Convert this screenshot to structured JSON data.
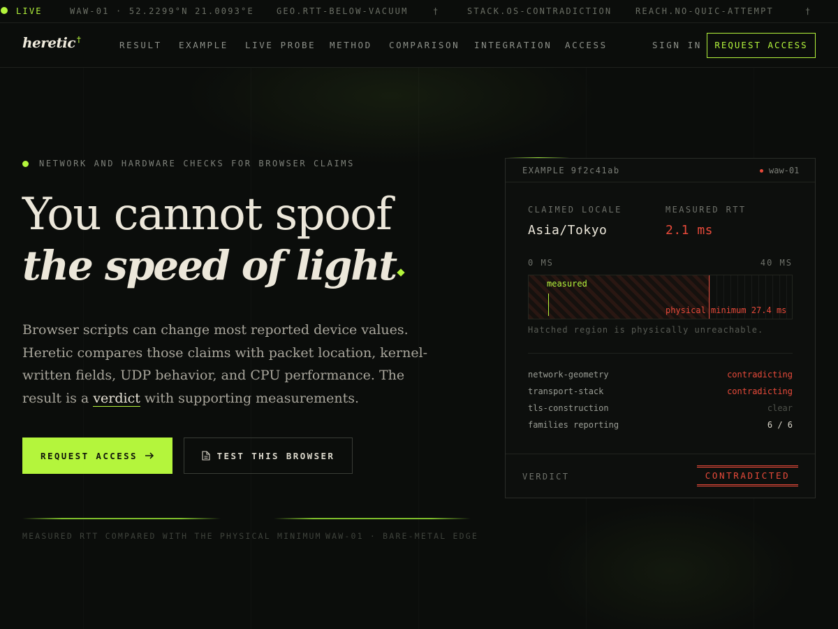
{
  "ticker": {
    "live": "LIVE",
    "items": [
      "WAW-01 · 52.2299°N 21.0093°E",
      "GEO.RTT-BELOW-VACUUM",
      "†",
      "STACK.OS-CONTRADICTION",
      "REACH.NO-QUIC-ATTEMPT",
      "†"
    ]
  },
  "nav": {
    "logo": "heretic",
    "logo_mark": "†",
    "links": [
      "RESULT",
      "EXAMPLE",
      "LIVE PROBE",
      "METHOD",
      "COMPARISON",
      "INTEGRATION",
      "ACCESS"
    ],
    "sign_in": "SIGN IN",
    "request_access": "REQUEST ACCESS"
  },
  "hero": {
    "eyebrow": "NETWORK AND HARDWARE CHECKS FOR BROWSER CLAIMS",
    "headline_line1": "You cannot spoof",
    "headline_line2": "the speed of light",
    "lede_before": "Browser scripts can change most reported device values. Heretic compares those claims with packet location, kernel-written fields, UDP behavior, and CPU performance. The result is a ",
    "lede_highlight": "verdict",
    "lede_after": " with supporting measurements.",
    "primary_button": "REQUEST ACCESS",
    "secondary_button": "TEST THIS BROWSER",
    "caption_left": "MEASURED RTT COMPARED WITH THE PHYSICAL MINIMUM",
    "caption_right": "WAW-01 · BARE-METAL EDGE"
  },
  "card": {
    "id": "EXAMPLE 9f2c41ab",
    "node": "waw-01",
    "claimed_locale_label": "CLAIMED LOCALE",
    "claimed_locale": "Asia/Tokyo",
    "measured_rtt_label": "MEASURED RTT",
    "measured_rtt": "2.1 ms",
    "scale_min": "0 MS",
    "scale_max": "40 MS",
    "measured_label": "measured",
    "physical_min_label": "physical minimum 27.4 ms",
    "scale_min_ms": 0,
    "scale_max_ms": 40,
    "measured_ms": 2.1,
    "physical_min_ms": 27.4,
    "note": "Hatched region is physically unreachable.",
    "rows": [
      {
        "key": "network-geometry",
        "value": "contradicting",
        "status": "bad"
      },
      {
        "key": "transport-stack",
        "value": "contradicting",
        "status": "bad"
      },
      {
        "key": "tls-construction",
        "value": "clear",
        "status": "muted"
      },
      {
        "key": "families reporting",
        "value": "6 / 6",
        "status": "plain"
      }
    ],
    "verdict_label": "VERDICT",
    "verdict": "CONTRADICTED"
  },
  "colors": {
    "accent": "#b4f53c",
    "danger": "#e84a3a",
    "background": "#0b0d0b",
    "text": "#ece7da"
  }
}
